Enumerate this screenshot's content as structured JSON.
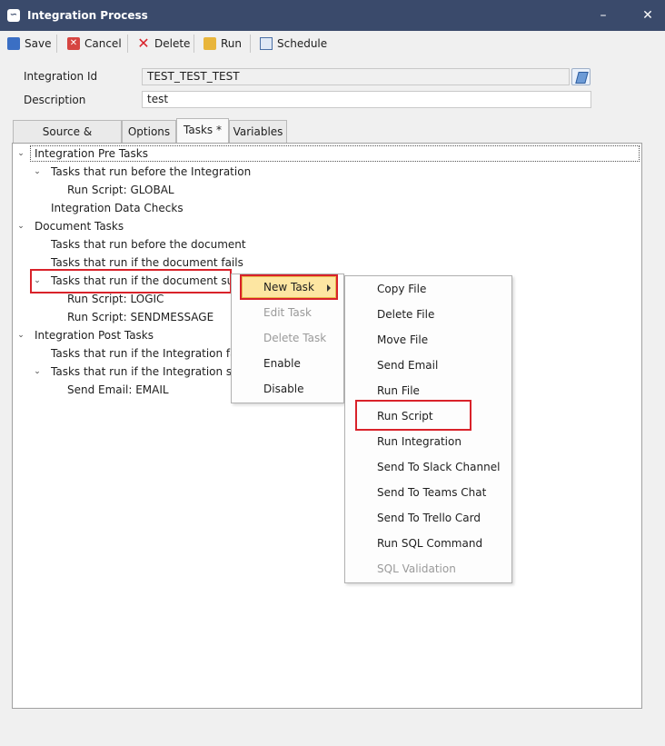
{
  "window": {
    "title": "Integration Process",
    "app_icon": "link-icon"
  },
  "toolbar": {
    "save": "Save",
    "cancel": "Cancel",
    "delete": "Delete",
    "run": "Run",
    "schedule": "Schedule"
  },
  "form": {
    "integration_id_label": "Integration Id",
    "integration_id_value": "TEST_TEST_TEST",
    "description_label": "Description",
    "description_value": "test"
  },
  "tabs": [
    "Source & Destination",
    "Options",
    "Tasks *",
    "Variables"
  ],
  "tree": [
    "Integration Pre Tasks",
    "Tasks that run before the Integration",
    "Run Script: GLOBAL",
    "Integration Data Checks",
    "Document Tasks",
    "Tasks that run before the document",
    "Tasks that run if the document fails",
    "Tasks that run if the document succeeds",
    "Run Script: LOGIC",
    "Run Script: SENDMESSAGE",
    "Integration Post Tasks",
    "Tasks that run if the Integration fails",
    "Tasks that run if the Integration succeeds",
    "Send Email: EMAIL"
  ],
  "context_menu": [
    "New Task",
    "Edit Task",
    "Delete Task",
    "Enable",
    "Disable"
  ],
  "submenu": [
    "Copy File",
    "Delete File",
    "Move File",
    "Send Email",
    "Run File",
    "Run Script",
    "Run Integration",
    "Send To Slack Channel",
    "Send To Teams Chat",
    "Send To Trello Card",
    "Run SQL Command",
    "SQL Validation"
  ],
  "colors": {
    "title_bar": "#3a4a6b",
    "highlight_box": "#d9222a",
    "menu_hover": "#fde6a2"
  }
}
